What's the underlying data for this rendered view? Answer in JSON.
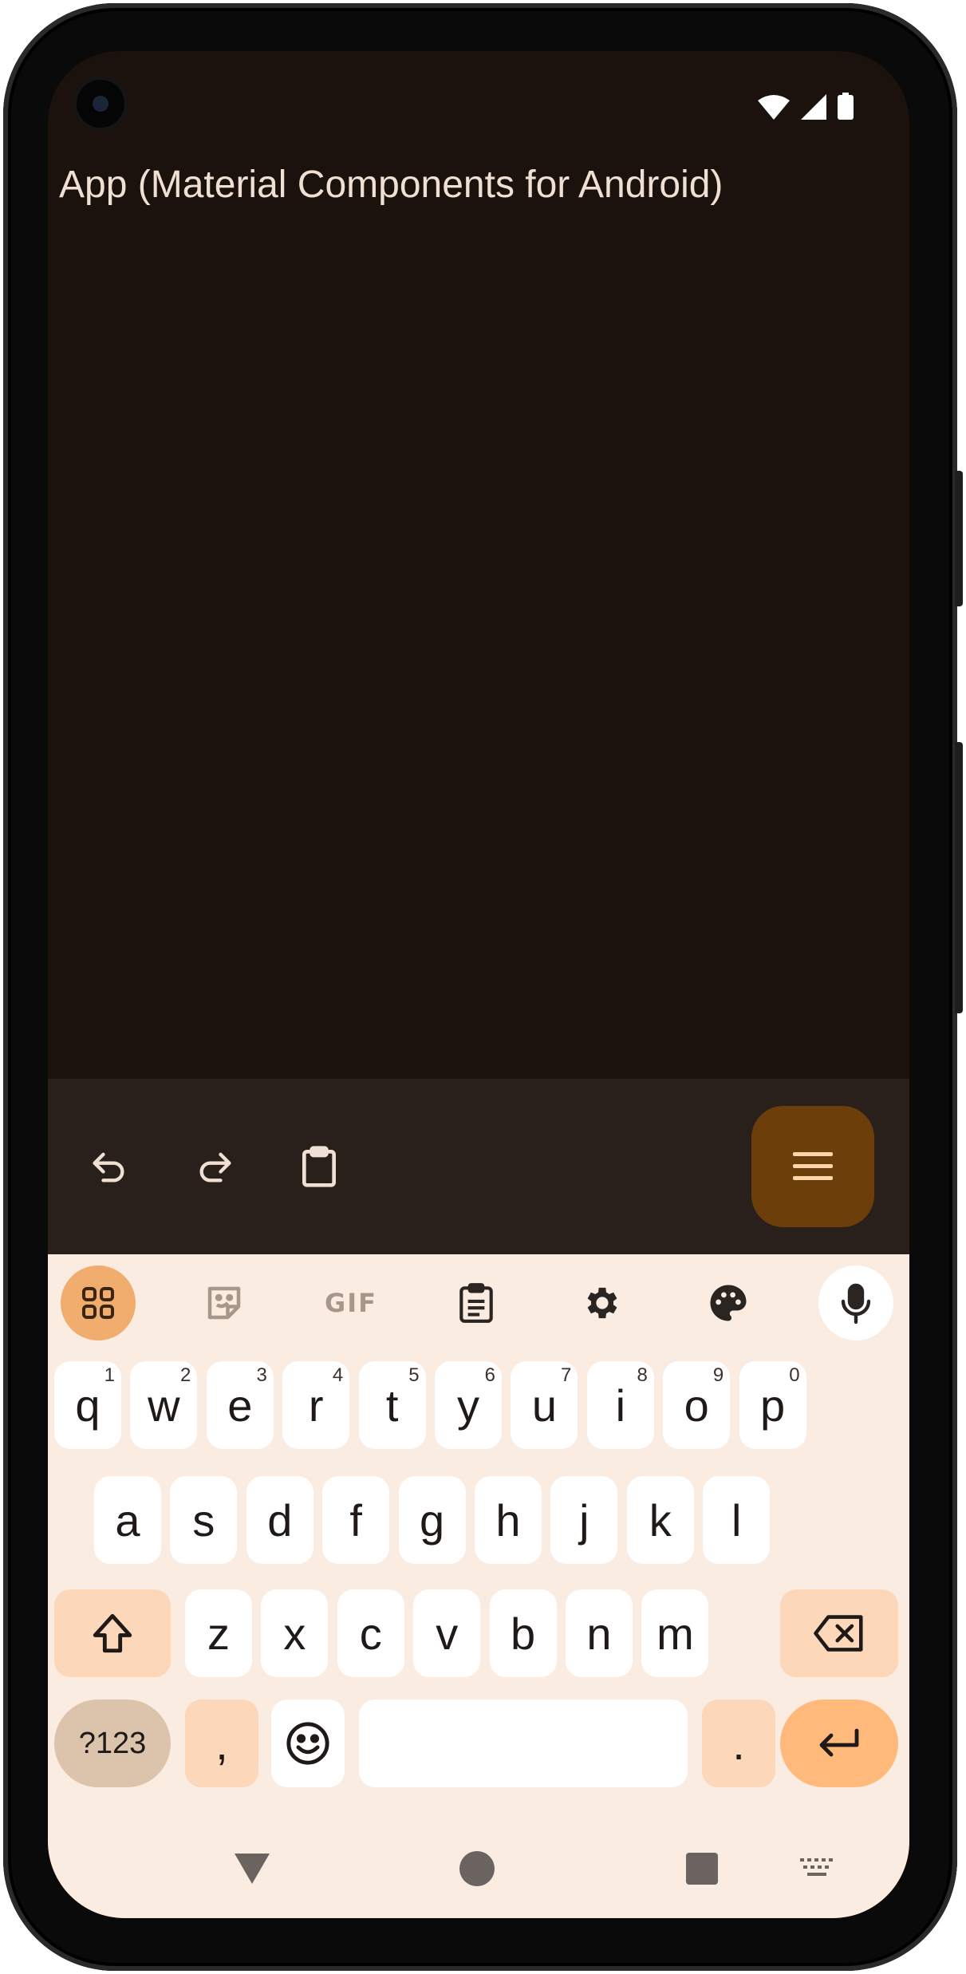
{
  "app": {
    "title": "App (Material Components for Android)"
  },
  "colors": {
    "screen_bg": "#1b120d",
    "toolbar_bg": "#29201b",
    "fab_bg": "#6c3f0a",
    "keyboard_bg": "#fbece2",
    "accent": "#f0ad6d"
  },
  "toolbar": {
    "buttons": [
      {
        "name": "undo-icon"
      },
      {
        "name": "redo-icon"
      },
      {
        "name": "clipboard-icon"
      }
    ],
    "fab_icon": "menu-icon"
  },
  "keyboard": {
    "toolbar_icons": [
      "apps-grid-icon",
      "sticker-icon",
      "gif-icon",
      "clipboard-icon",
      "gear-icon",
      "palette-icon",
      "microphone-icon"
    ],
    "gif_label": "GIF",
    "row1": [
      {
        "key": "q",
        "sup": "1"
      },
      {
        "key": "w",
        "sup": "2"
      },
      {
        "key": "e",
        "sup": "3"
      },
      {
        "key": "r",
        "sup": "4"
      },
      {
        "key": "t",
        "sup": "5"
      },
      {
        "key": "y",
        "sup": "6"
      },
      {
        "key": "u",
        "sup": "7"
      },
      {
        "key": "i",
        "sup": "8"
      },
      {
        "key": "o",
        "sup": "9"
      },
      {
        "key": "p",
        "sup": "0"
      }
    ],
    "row2": [
      "a",
      "s",
      "d",
      "f",
      "g",
      "h",
      "j",
      "k",
      "l"
    ],
    "row3": [
      "z",
      "x",
      "c",
      "v",
      "b",
      "n",
      "m"
    ],
    "symbols_label": "?123",
    "comma_label": ",",
    "period_label": "."
  },
  "nav": {
    "icons": [
      "back-icon",
      "home-icon",
      "recents-icon",
      "keyboard-switch-icon"
    ]
  }
}
